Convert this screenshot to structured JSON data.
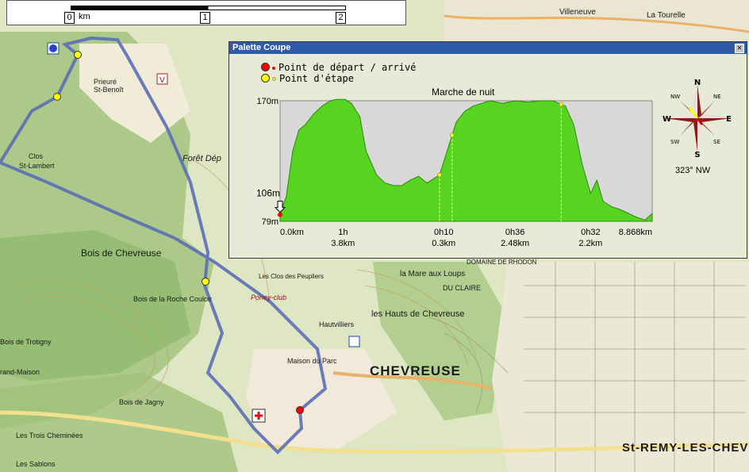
{
  "window": {
    "title": "Palette Coupe",
    "close_icon": "close-icon"
  },
  "scale_bar": {
    "labels": [
      "0",
      "1",
      "2"
    ],
    "unit": "km"
  },
  "legend": {
    "start_label": "Point de départ / arrivé",
    "waypoint_label": "Point d'étape",
    "start_color": "#ff0000",
    "waypoint_color": "#ffff00"
  },
  "chart_data": {
    "type": "area",
    "title": "Marche de nuit",
    "ylim": [
      79,
      170
    ],
    "xlim": [
      0,
      8.868
    ],
    "y_tick_labels": [
      "170m",
      "79m"
    ],
    "min_annotation": "106m",
    "x": [
      0,
      0.15,
      0.3,
      0.45,
      0.6,
      0.8,
      1.0,
      1.2,
      1.35,
      1.55,
      1.7,
      1.9,
      2.05,
      2.3,
      2.5,
      2.7,
      2.9,
      3.1,
      3.3,
      3.5,
      3.8,
      4.0,
      4.2,
      4.4,
      4.6,
      4.8,
      5.0,
      5.3,
      5.6,
      5.9,
      6.2,
      6.5,
      6.8,
      7.0,
      7.2,
      7.4,
      7.55,
      7.7,
      7.9,
      8.1,
      8.3,
      8.5,
      8.7,
      8.868
    ],
    "y": [
      84,
      98,
      132,
      148,
      152,
      160,
      166,
      170,
      171,
      171,
      168,
      158,
      132,
      114,
      108,
      106,
      106,
      110,
      113,
      108,
      114,
      134,
      154,
      162,
      166,
      168,
      170,
      168,
      170,
      169,
      170,
      170,
      166,
      152,
      122,
      100,
      110,
      94,
      90,
      88,
      85,
      82,
      80,
      85
    ],
    "x_tick_labels": [
      {
        "time": "",
        "dist": "0.0km",
        "x": 0
      },
      {
        "time": "1h",
        "dist": "3.8km",
        "x": 1.5
      },
      {
        "time": "0h10",
        "dist": "0.3km",
        "x": 3.9
      },
      {
        "time": "0h36",
        "dist": "2.48km",
        "x": 5.6
      },
      {
        "time": "0h32",
        "dist": "2.2km",
        "x": 7.4
      },
      {
        "time": "",
        "dist": "8.868km",
        "x": 8.868
      }
    ],
    "waypoints_x": [
      3.8,
      4.1,
      6.7
    ],
    "start_x": 0,
    "fill_color": "#56d421",
    "bg_color": "#d8d8d8"
  },
  "compass": {
    "N": "N",
    "S": "S",
    "E": "E",
    "W": "W",
    "NE": "NE",
    "NW": "NW",
    "SE": "SE",
    "SW": "SW",
    "heading": "323° NW"
  },
  "map_labels": {
    "villeneuve": "Villeneuve",
    "la_tourelle": "La Tourelle",
    "prieure": "Prieuré",
    "st_benoit": "St-Benoît",
    "clos": "Clos",
    "st_lambert": "St-Lambert",
    "foret": "Forêt Dép",
    "bois_chevreuse": "Bois de Chevreuse",
    "bois_roche": "Bois de la Roche Couloir",
    "bois_trotigny": "Bois de Trotigny",
    "grand_maison": "rand-Maison",
    "bois_jagny": "Bois de Jagny",
    "trois_cheminees": "Les Trois Cheminées",
    "sablons": "Les Sablons",
    "maison_parc": "Maison du Parc",
    "chevreuse": "CHEVREUSE",
    "hauts": "les Hauts de Chevreuse",
    "mare_loups": "la Mare aux Loups",
    "du_claire": "DU CLAIRE",
    "hautvilliers": "Hautvilliers",
    "st_remy": "St-REMY-LES-CHEV",
    "rhodon": "DOMAINE DE RHODON",
    "poney": "Poney-club",
    "clos_peupliers": "Les Clos des Peupliers"
  }
}
